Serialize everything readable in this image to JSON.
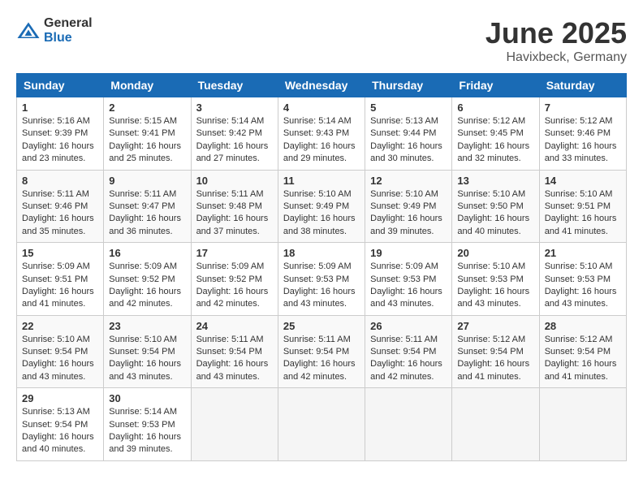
{
  "header": {
    "logo_general": "General",
    "logo_blue": "Blue",
    "month": "June 2025",
    "location": "Havixbeck, Germany"
  },
  "weekdays": [
    "Sunday",
    "Monday",
    "Tuesday",
    "Wednesday",
    "Thursday",
    "Friday",
    "Saturday"
  ],
  "weeks": [
    [
      {
        "day": "1",
        "sunrise": "Sunrise: 5:16 AM",
        "sunset": "Sunset: 9:39 PM",
        "daylight": "Daylight: 16 hours and 23 minutes."
      },
      {
        "day": "2",
        "sunrise": "Sunrise: 5:15 AM",
        "sunset": "Sunset: 9:41 PM",
        "daylight": "Daylight: 16 hours and 25 minutes."
      },
      {
        "day": "3",
        "sunrise": "Sunrise: 5:14 AM",
        "sunset": "Sunset: 9:42 PM",
        "daylight": "Daylight: 16 hours and 27 minutes."
      },
      {
        "day": "4",
        "sunrise": "Sunrise: 5:14 AM",
        "sunset": "Sunset: 9:43 PM",
        "daylight": "Daylight: 16 hours and 29 minutes."
      },
      {
        "day": "5",
        "sunrise": "Sunrise: 5:13 AM",
        "sunset": "Sunset: 9:44 PM",
        "daylight": "Daylight: 16 hours and 30 minutes."
      },
      {
        "day": "6",
        "sunrise": "Sunrise: 5:12 AM",
        "sunset": "Sunset: 9:45 PM",
        "daylight": "Daylight: 16 hours and 32 minutes."
      },
      {
        "day": "7",
        "sunrise": "Sunrise: 5:12 AM",
        "sunset": "Sunset: 9:46 PM",
        "daylight": "Daylight: 16 hours and 33 minutes."
      }
    ],
    [
      {
        "day": "8",
        "sunrise": "Sunrise: 5:11 AM",
        "sunset": "Sunset: 9:46 PM",
        "daylight": "Daylight: 16 hours and 35 minutes."
      },
      {
        "day": "9",
        "sunrise": "Sunrise: 5:11 AM",
        "sunset": "Sunset: 9:47 PM",
        "daylight": "Daylight: 16 hours and 36 minutes."
      },
      {
        "day": "10",
        "sunrise": "Sunrise: 5:11 AM",
        "sunset": "Sunset: 9:48 PM",
        "daylight": "Daylight: 16 hours and 37 minutes."
      },
      {
        "day": "11",
        "sunrise": "Sunrise: 5:10 AM",
        "sunset": "Sunset: 9:49 PM",
        "daylight": "Daylight: 16 hours and 38 minutes."
      },
      {
        "day": "12",
        "sunrise": "Sunrise: 5:10 AM",
        "sunset": "Sunset: 9:49 PM",
        "daylight": "Daylight: 16 hours and 39 minutes."
      },
      {
        "day": "13",
        "sunrise": "Sunrise: 5:10 AM",
        "sunset": "Sunset: 9:50 PM",
        "daylight": "Daylight: 16 hours and 40 minutes."
      },
      {
        "day": "14",
        "sunrise": "Sunrise: 5:10 AM",
        "sunset": "Sunset: 9:51 PM",
        "daylight": "Daylight: 16 hours and 41 minutes."
      }
    ],
    [
      {
        "day": "15",
        "sunrise": "Sunrise: 5:09 AM",
        "sunset": "Sunset: 9:51 PM",
        "daylight": "Daylight: 16 hours and 41 minutes."
      },
      {
        "day": "16",
        "sunrise": "Sunrise: 5:09 AM",
        "sunset": "Sunset: 9:52 PM",
        "daylight": "Daylight: 16 hours and 42 minutes."
      },
      {
        "day": "17",
        "sunrise": "Sunrise: 5:09 AM",
        "sunset": "Sunset: 9:52 PM",
        "daylight": "Daylight: 16 hours and 42 minutes."
      },
      {
        "day": "18",
        "sunrise": "Sunrise: 5:09 AM",
        "sunset": "Sunset: 9:53 PM",
        "daylight": "Daylight: 16 hours and 43 minutes."
      },
      {
        "day": "19",
        "sunrise": "Sunrise: 5:09 AM",
        "sunset": "Sunset: 9:53 PM",
        "daylight": "Daylight: 16 hours and 43 minutes."
      },
      {
        "day": "20",
        "sunrise": "Sunrise: 5:10 AM",
        "sunset": "Sunset: 9:53 PM",
        "daylight": "Daylight: 16 hours and 43 minutes."
      },
      {
        "day": "21",
        "sunrise": "Sunrise: 5:10 AM",
        "sunset": "Sunset: 9:53 PM",
        "daylight": "Daylight: 16 hours and 43 minutes."
      }
    ],
    [
      {
        "day": "22",
        "sunrise": "Sunrise: 5:10 AM",
        "sunset": "Sunset: 9:54 PM",
        "daylight": "Daylight: 16 hours and 43 minutes."
      },
      {
        "day": "23",
        "sunrise": "Sunrise: 5:10 AM",
        "sunset": "Sunset: 9:54 PM",
        "daylight": "Daylight: 16 hours and 43 minutes."
      },
      {
        "day": "24",
        "sunrise": "Sunrise: 5:11 AM",
        "sunset": "Sunset: 9:54 PM",
        "daylight": "Daylight: 16 hours and 43 minutes."
      },
      {
        "day": "25",
        "sunrise": "Sunrise: 5:11 AM",
        "sunset": "Sunset: 9:54 PM",
        "daylight": "Daylight: 16 hours and 42 minutes."
      },
      {
        "day": "26",
        "sunrise": "Sunrise: 5:11 AM",
        "sunset": "Sunset: 9:54 PM",
        "daylight": "Daylight: 16 hours and 42 minutes."
      },
      {
        "day": "27",
        "sunrise": "Sunrise: 5:12 AM",
        "sunset": "Sunset: 9:54 PM",
        "daylight": "Daylight: 16 hours and 41 minutes."
      },
      {
        "day": "28",
        "sunrise": "Sunrise: 5:12 AM",
        "sunset": "Sunset: 9:54 PM",
        "daylight": "Daylight: 16 hours and 41 minutes."
      }
    ],
    [
      {
        "day": "29",
        "sunrise": "Sunrise: 5:13 AM",
        "sunset": "Sunset: 9:54 PM",
        "daylight": "Daylight: 16 hours and 40 minutes."
      },
      {
        "day": "30",
        "sunrise": "Sunrise: 5:14 AM",
        "sunset": "Sunset: 9:53 PM",
        "daylight": "Daylight: 16 hours and 39 minutes."
      },
      null,
      null,
      null,
      null,
      null
    ]
  ]
}
